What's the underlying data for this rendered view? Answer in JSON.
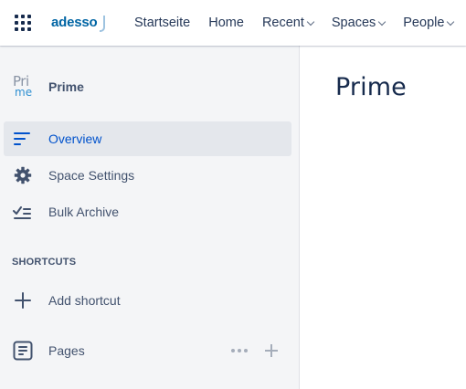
{
  "header": {
    "logo_text": "adesso",
    "nav": [
      {
        "label": "Startseite",
        "dropdown": false
      },
      {
        "label": "Home",
        "dropdown": false
      },
      {
        "label": "Recent",
        "dropdown": true
      },
      {
        "label": "Spaces",
        "dropdown": true
      },
      {
        "label": "People",
        "dropdown": true
      }
    ]
  },
  "sidebar": {
    "space": {
      "avatar_top": "Pri",
      "avatar_bottom": "me",
      "title": "Prime"
    },
    "items": [
      {
        "label": "Overview",
        "icon": "overview-lines-icon",
        "active": true
      },
      {
        "label": "Space Settings",
        "icon": "gear-icon",
        "active": false
      },
      {
        "label": "Bulk Archive",
        "icon": "bulk-archive-icon",
        "active": false
      }
    ],
    "shortcuts_heading": "SHORTCUTS",
    "add_shortcut_label": "Add shortcut",
    "pages_label": "Pages"
  },
  "main": {
    "title": "Prime"
  },
  "colors": {
    "accent": "#0052cc",
    "sidebar_bg": "#f4f5f7",
    "active_bg": "#e4e7ec",
    "logo": "#0065a4"
  }
}
